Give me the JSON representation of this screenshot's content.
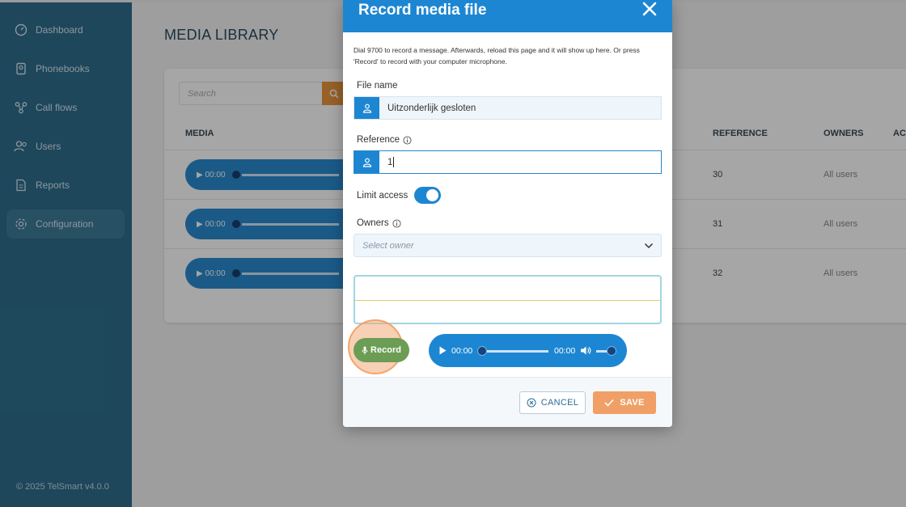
{
  "sidebar": {
    "items": [
      {
        "label": "Dashboard",
        "icon": "dashboard-icon"
      },
      {
        "label": "Phonebooks",
        "icon": "phonebook-icon"
      },
      {
        "label": "Call flows",
        "icon": "call-flow-icon"
      },
      {
        "label": "Users",
        "icon": "users-icon"
      },
      {
        "label": "Reports",
        "icon": "report-icon"
      },
      {
        "label": "Configuration",
        "icon": "gear-icon",
        "active": true
      }
    ],
    "footer": "© 2025 TelSmart  v4.0.0"
  },
  "library": {
    "title": "MEDIA LIBRARY",
    "search_placeholder": "Search",
    "columns": {
      "media": "MEDIA",
      "reference": "REFERENCE",
      "owners": "OWNERS",
      "actions": "AC"
    },
    "rows": [
      {
        "time": "00:00",
        "reference": "30",
        "owners": "All users"
      },
      {
        "time": "00:00",
        "reference": "31",
        "owners": "All users"
      },
      {
        "time": "00:00",
        "reference": "32",
        "owners": "All users"
      }
    ]
  },
  "modal": {
    "title": "Record media file",
    "intro": "Dial 9700 to record a message. Afterwards, reload this page and it will show up here. Or press 'Record' to record with your computer microphone.",
    "file_name_label": "File name",
    "file_name_value": "Uitzonderlijk gesloten",
    "reference_label": "Reference",
    "reference_value": "1",
    "limit_access_label": "Limit access",
    "limit_access_on": true,
    "owners_label": "Owners",
    "owners_placeholder": "Select owner",
    "record_label": "Record",
    "player_current": "00:00",
    "player_duration": "00:00",
    "cancel_label": "CANCEL",
    "save_label": "SAVE"
  },
  "colors": {
    "primary": "#1d86d2",
    "sidebar": "#2e6e8e",
    "record": "#6c9d54",
    "save": "#f0a066"
  }
}
